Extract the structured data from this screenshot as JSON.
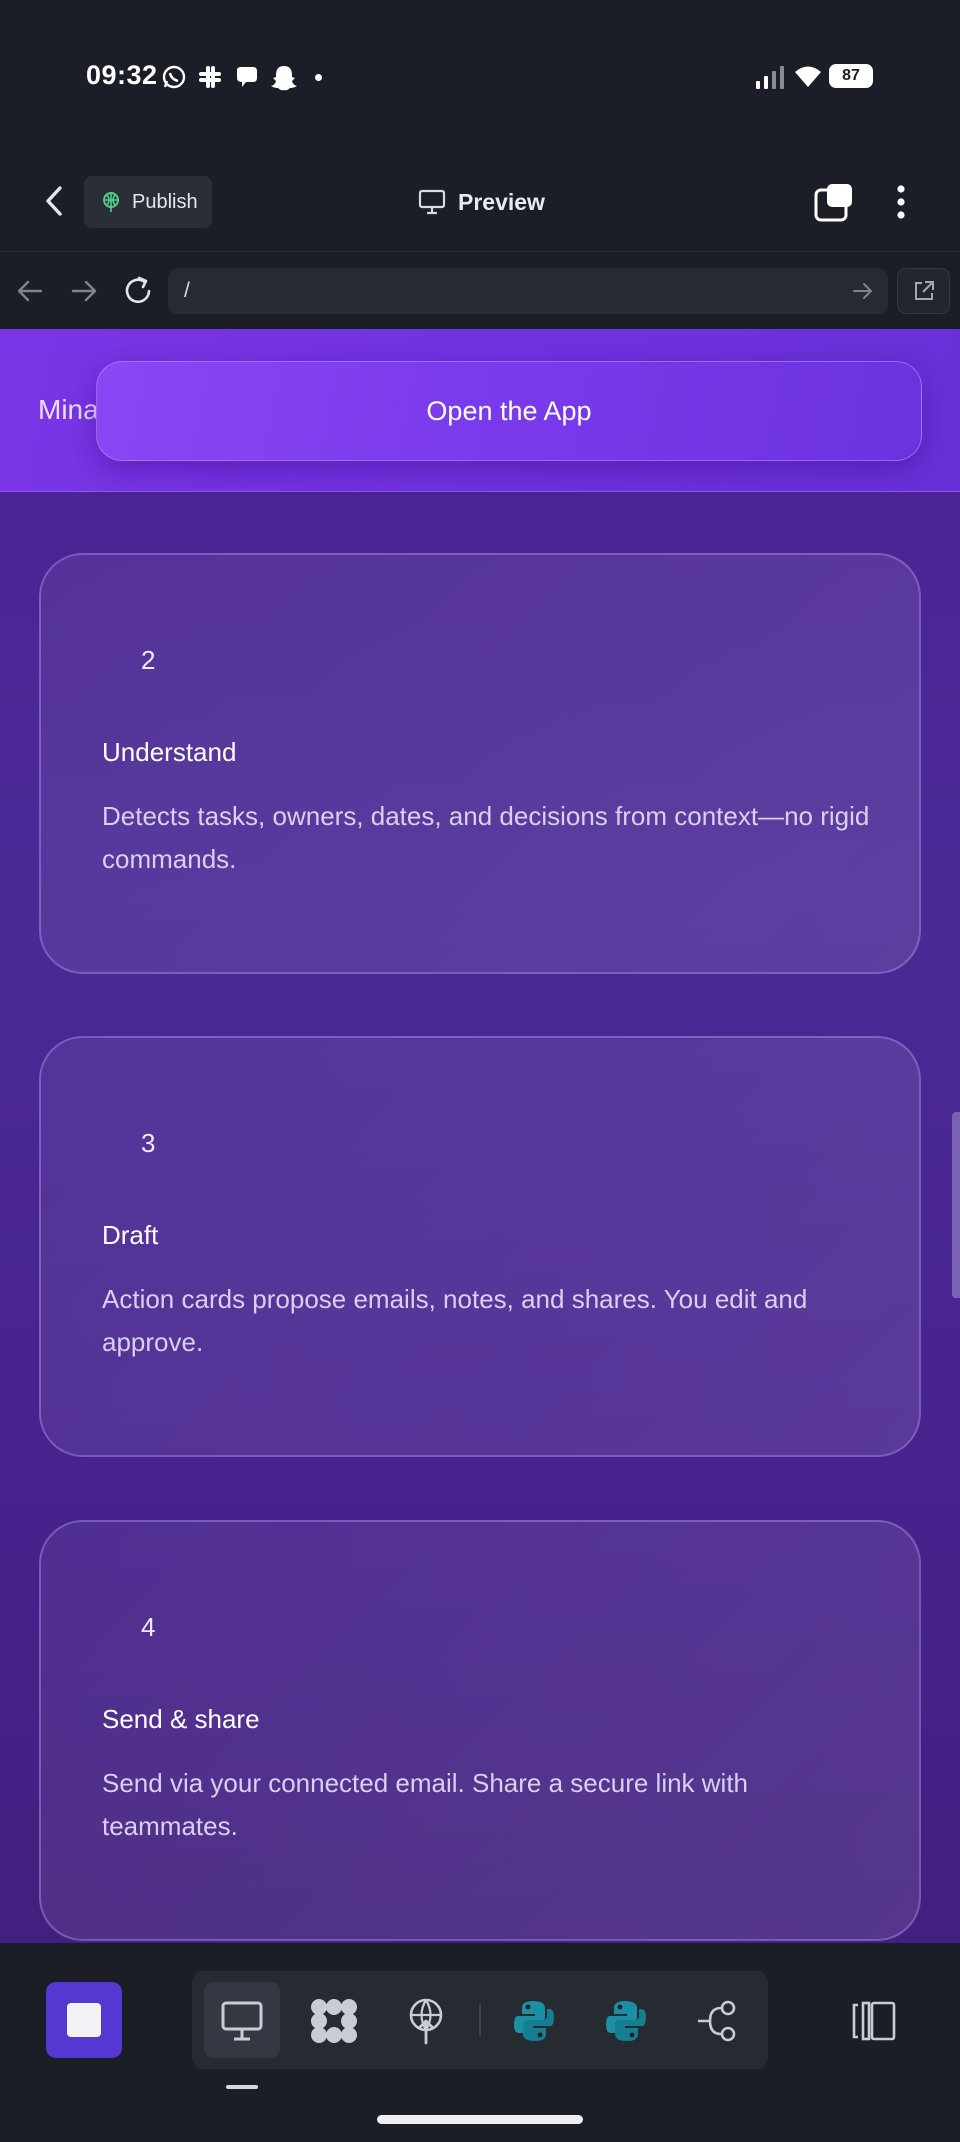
{
  "status_bar": {
    "time": "09:32",
    "battery": "87",
    "notification_icons": [
      "whatsapp-icon",
      "slack-icon",
      "chat-bubble-icon",
      "snapchat-icon",
      "dot-icon"
    ],
    "system_icons": [
      "signal-icon",
      "wifi-icon",
      "battery-icon"
    ]
  },
  "top_bar": {
    "publish_label": "Publish",
    "preview_label": "Preview",
    "icons": [
      "back-chevron-icon",
      "publish-icon",
      "monitor-icon",
      "tabs-icon",
      "more-vertical-icon"
    ]
  },
  "url_bar": {
    "url": "/",
    "icons": [
      "back-arrow-icon",
      "forward-arrow-icon",
      "reload-icon",
      "go-arrow-icon",
      "external-link-icon"
    ]
  },
  "site": {
    "brand": "Mina",
    "cta_label": "Open the App",
    "steps": [
      {
        "number": "2",
        "title": "Understand",
        "description": "Detects tasks, owners, dates, and decisions from context—no rigid commands."
      },
      {
        "number": "3",
        "title": "Draft",
        "description": "Action cards propose emails, notes, and shares. You edit and approve."
      },
      {
        "number": "4",
        "title": "Send & share",
        "description": "Send via your connected email. Share a secure link with teammates."
      }
    ]
  },
  "bottom_toolbar": {
    "tools": [
      "stop-icon",
      "desktop-preview-icon",
      "apps-grid-icon",
      "deploy-icon",
      "python-icon",
      "python-icon",
      "workflow-icon",
      "panel-toggle-icon"
    ],
    "colors": {
      "stop_button": "#5537d1",
      "python": "#1b8fa3"
    }
  },
  "colors": {
    "header_gradient_start": "#7a35e6",
    "content_background": "#4a2392",
    "app_background": "#1b1e26"
  }
}
